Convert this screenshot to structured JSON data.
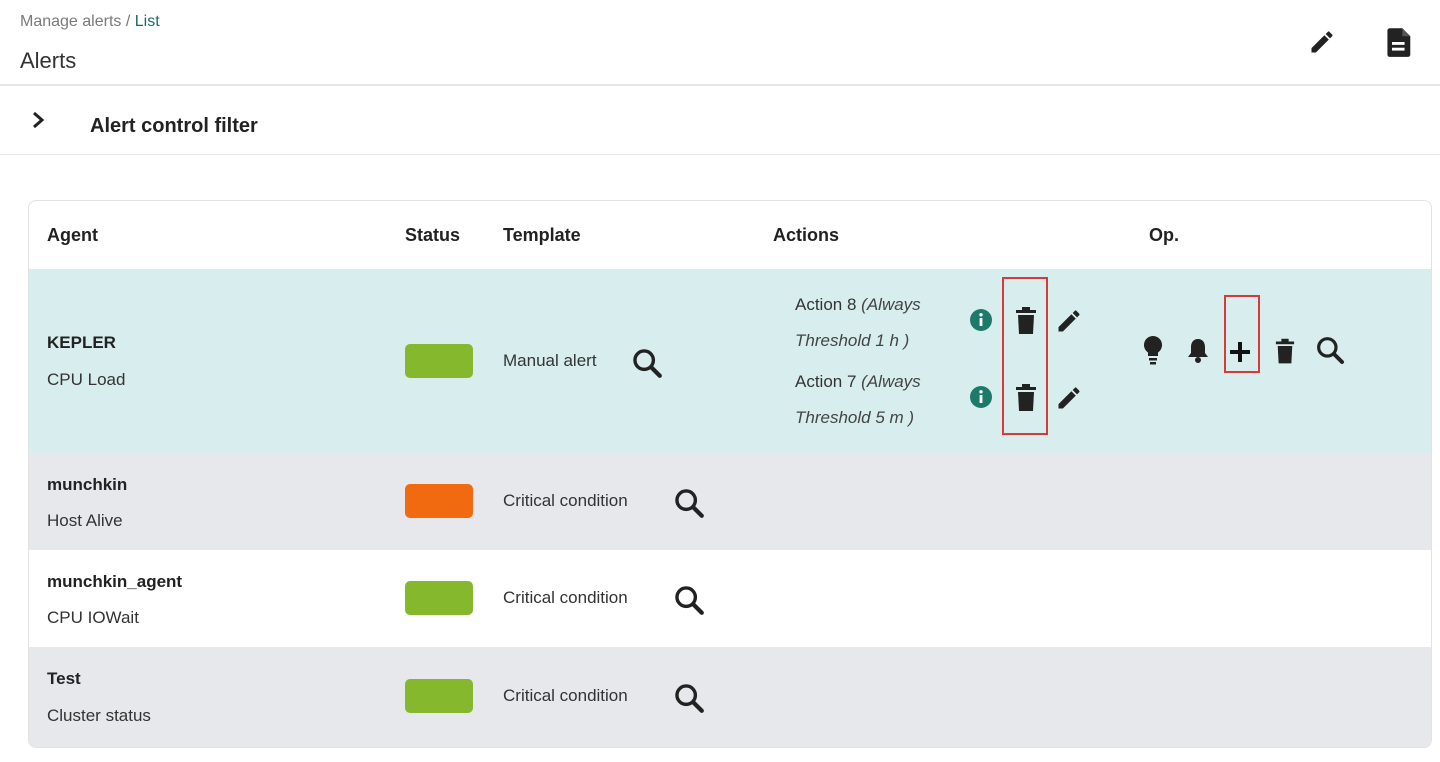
{
  "breadcrumb": {
    "parent": "Manage alerts /",
    "current": "List"
  },
  "page": {
    "title": "Alerts"
  },
  "header_icons": [
    "pencil-icon",
    "document-icon"
  ],
  "filter": {
    "title": "Alert control filter"
  },
  "table": {
    "columns": [
      "Agent",
      "Status",
      "Template",
      "Actions",
      "Op."
    ],
    "rows": [
      {
        "agent": "KEPLER",
        "module": "CPU Load",
        "status_color": "#86b82e",
        "template": "Manual alert",
        "actions": [
          {
            "name": "Action 8",
            "detail_line1": "(Always",
            "detail_line2": "Threshold 1 h )"
          },
          {
            "name": "Action 7",
            "detail_line1": "(Always",
            "detail_line2": "Threshold 5 m )"
          }
        ],
        "op_icons": [
          "lightbulb-icon",
          "bell-icon",
          "plus-icon",
          "trash-icon",
          "search-icon"
        ]
      },
      {
        "agent": "munchkin",
        "module": "Host Alive",
        "status_color": "#f26a0f",
        "template": "Critical condition"
      },
      {
        "agent": "munchkin_agent",
        "module": "CPU IOWait",
        "status_color": "#86b82e",
        "template": "Critical condition"
      },
      {
        "agent": "Test",
        "module": "Cluster status",
        "status_color": "#86b82e",
        "template": "Critical condition"
      }
    ]
  },
  "colors": {
    "accent": "#1d6a6a",
    "info": "#1d7a6a",
    "highlight": "#d63a3a",
    "ok": "#86b82e",
    "critical": "#f26a0f"
  }
}
